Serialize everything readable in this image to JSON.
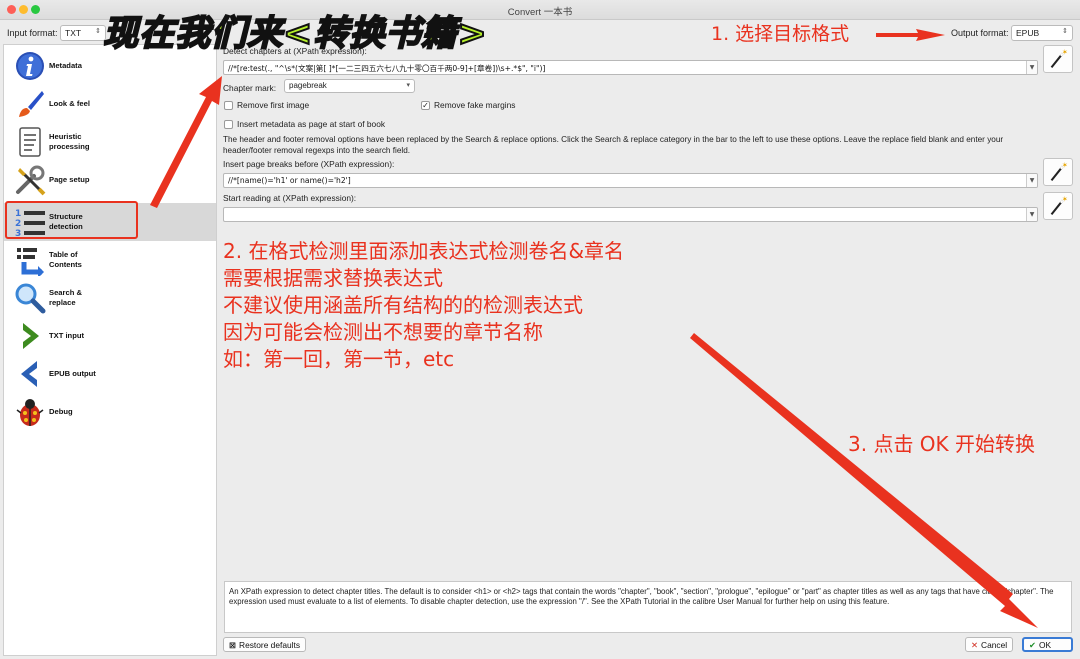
{
  "window": {
    "title": "Convert 一本书"
  },
  "format_bar": {
    "input_label": "Input format:",
    "input_value": "TXT",
    "output_label": "Output format:",
    "output_value": "EPUB"
  },
  "sidebar": {
    "items": [
      {
        "label": "Metadata",
        "icon": "info-icon"
      },
      {
        "label": "Look & feel",
        "icon": "brush-icon"
      },
      {
        "label": "Heuristic\nprocessing",
        "icon": "document-icon"
      },
      {
        "label": "Page setup",
        "icon": "tools-icon"
      },
      {
        "label": "Structure\ndetection",
        "icon": "numbered-list-icon",
        "selected": true
      },
      {
        "label": "Table of\nContents",
        "icon": "toc-icon"
      },
      {
        "label": "Search &\nreplace",
        "icon": "magnifier-icon"
      },
      {
        "label": "TXT input",
        "icon": "arrow-right-icon"
      },
      {
        "label": "EPUB output",
        "icon": "arrow-left-icon"
      },
      {
        "label": "Debug",
        "icon": "bug-icon"
      }
    ]
  },
  "structure": {
    "detect_chapters_label": "Detect chapters at (XPath expression):",
    "detect_chapters_value": "//*[re:test(., \"^\\s*(文案|第[ ]*[一二三四五六七八九十零〇百千两0-9]+[章卷])\\s+.*$\", \"i\")]",
    "chapter_mark_label": "Chapter mark:",
    "chapter_mark_value": "pagebreak",
    "remove_first_image": "Remove first image",
    "remove_fake_margins": "Remove fake margins",
    "insert_metadata": "Insert metadata as page at start of book",
    "note": "The header and footer removal options have been replaced by the Search & replace options. Click the Search & replace category in the bar to the left to use these options. Leave the replace field blank and enter your header/footer removal regexps into the search field.",
    "page_breaks_label": "Insert page breaks before (XPath expression):",
    "page_breaks_value": "//*[name()='h1' or name()='h2']",
    "start_reading_label": "Start reading at (XPath expression):",
    "start_reading_value": "",
    "help": "An XPath expression to detect chapter titles. The default is to consider <h1> or <h2> tags that contain the words \"chapter\", \"book\", \"section\", \"prologue\", \"epilogue\" or \"part\" as chapter titles as well as any tags that have class=\"chapter\". The expression used must evaluate to a list of elements. To disable chapter detection, use the expression \"/\". See the XPath Tutorial in the calibre User Manual for further help on using this feature."
  },
  "buttons": {
    "restore": "Restore defaults",
    "cancel": "Cancel",
    "ok": "OK"
  },
  "annotations": {
    "banner": "现在我们来<转换书籍>",
    "step1": "1. 选择目标格式",
    "step2_lines": [
      "2. 在格式检测里面添加表达式检测卷名&章名",
      "需要根据需求替换表达式",
      "不建议使用涵盖所有结构的的检测表达式",
      "因为可能会检测出不想要的章节名称",
      "如：第一回，第一节，etc"
    ],
    "step3": "3. 点击 OK 开始转换",
    "color": "#e9321f"
  }
}
